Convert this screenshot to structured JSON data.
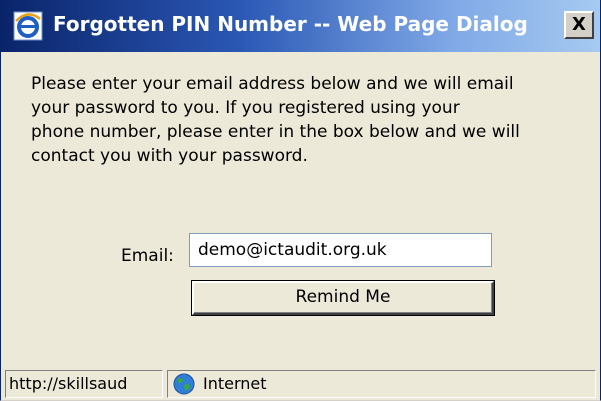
{
  "window": {
    "title": "Forgotten PIN Number -- Web Page Dialog",
    "close_glyph": "X"
  },
  "message": {
    "lines": [
      "Please enter your email address below and we will email",
      "your password to you. If you registered using your",
      "phone number, please enter in the box below and we will",
      "contact you with your password."
    ]
  },
  "form": {
    "email_label": "Email:",
    "email_value": "demo@ictaudit.org.uk",
    "submit_label": "Remind Me"
  },
  "statusbar": {
    "url": "http://skillsaud",
    "zone": "Internet"
  },
  "icons": {
    "title": "ie-logo-icon",
    "zone": "globe-icon"
  },
  "colors": {
    "title_start": "#0a246a",
    "title_end": "#a6caf0",
    "face": "#ece9d8"
  }
}
